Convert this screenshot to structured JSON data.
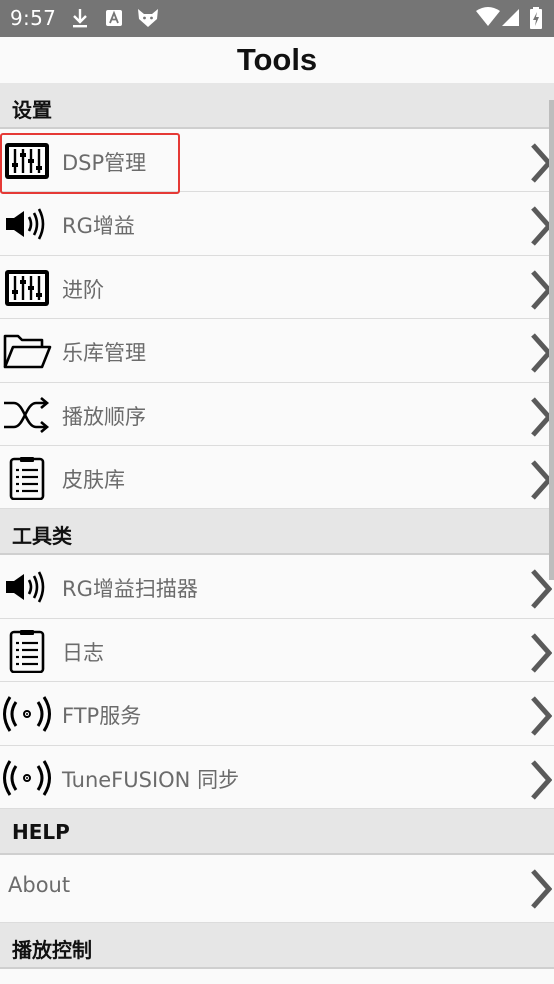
{
  "status_bar": {
    "time": "9:57",
    "left_icons": [
      "download-icon",
      "a-notification-icon",
      "fox-icon"
    ],
    "right_icons": [
      "wifi-icon",
      "signal-icon",
      "battery-icon"
    ]
  },
  "app": {
    "title": "Tools"
  },
  "sections": [
    {
      "header": "设置",
      "items": [
        {
          "label": "DSP管理",
          "icon": "equalizer-icon"
        },
        {
          "label": "RG增益",
          "icon": "speaker-icon"
        },
        {
          "label": "进阶",
          "icon": "equalizer-icon"
        },
        {
          "label": "乐库管理",
          "icon": "folder-icon"
        },
        {
          "label": "播放顺序",
          "icon": "shuffle-icon"
        },
        {
          "label": "皮肤库",
          "icon": "clipboard-icon"
        }
      ]
    },
    {
      "header": "工具类",
      "items": [
        {
          "label": "RG增益扫描器",
          "icon": "speaker-icon"
        },
        {
          "label": "日志",
          "icon": "clipboard-icon"
        },
        {
          "label": "FTP服务",
          "icon": "broadcast-icon"
        },
        {
          "label": "TuneFUSION 同步",
          "icon": "broadcast-icon"
        }
      ]
    },
    {
      "header": "HELP",
      "items": [
        {
          "label": "About",
          "icon": ""
        }
      ]
    },
    {
      "header": "播放控制",
      "items": []
    }
  ],
  "colors": {
    "status_bar": "#757575",
    "highlight": "#e53935",
    "header_bg": "#e6e6e6",
    "label": "#6b6b6b"
  }
}
